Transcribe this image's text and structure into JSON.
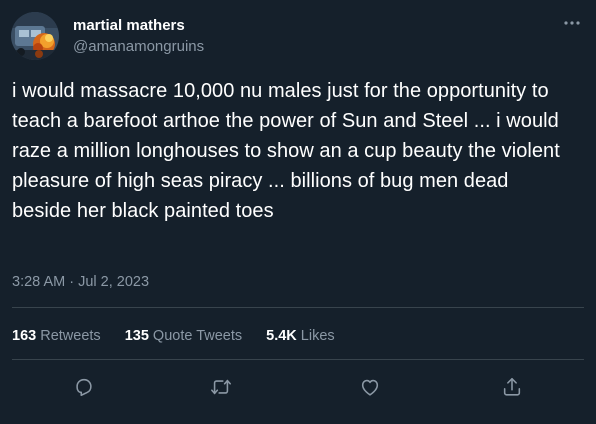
{
  "user": {
    "display_name": "martial mathers",
    "handle": "@amanamongruins",
    "avatar_icon": "avatar-image"
  },
  "tweet": {
    "text": "i would massacre 10,000 nu males just for the opportunity to teach a barefoot arthoe the power of Sun and Steel ... i would raze a million longhouses to show an a cup beauty the violent pleasure of high seas piracy ... billions of bug men dead beside her black painted toes",
    "timestamp": "3:28 AM · Jul 2, 2023"
  },
  "stats": [
    {
      "count": "163",
      "label": "Retweets"
    },
    {
      "count": "135",
      "label": "Quote Tweets"
    },
    {
      "count": "5.4K",
      "label": "Likes"
    }
  ],
  "actions": [
    {
      "icon": "reply-icon"
    },
    {
      "icon": "retweet-icon"
    },
    {
      "icon": "like-icon"
    },
    {
      "icon": "share-icon"
    }
  ],
  "colors": {
    "background": "#15202b",
    "text_primary": "#ffffff",
    "text_secondary": "#8b98a5",
    "divider": "#38444d"
  }
}
